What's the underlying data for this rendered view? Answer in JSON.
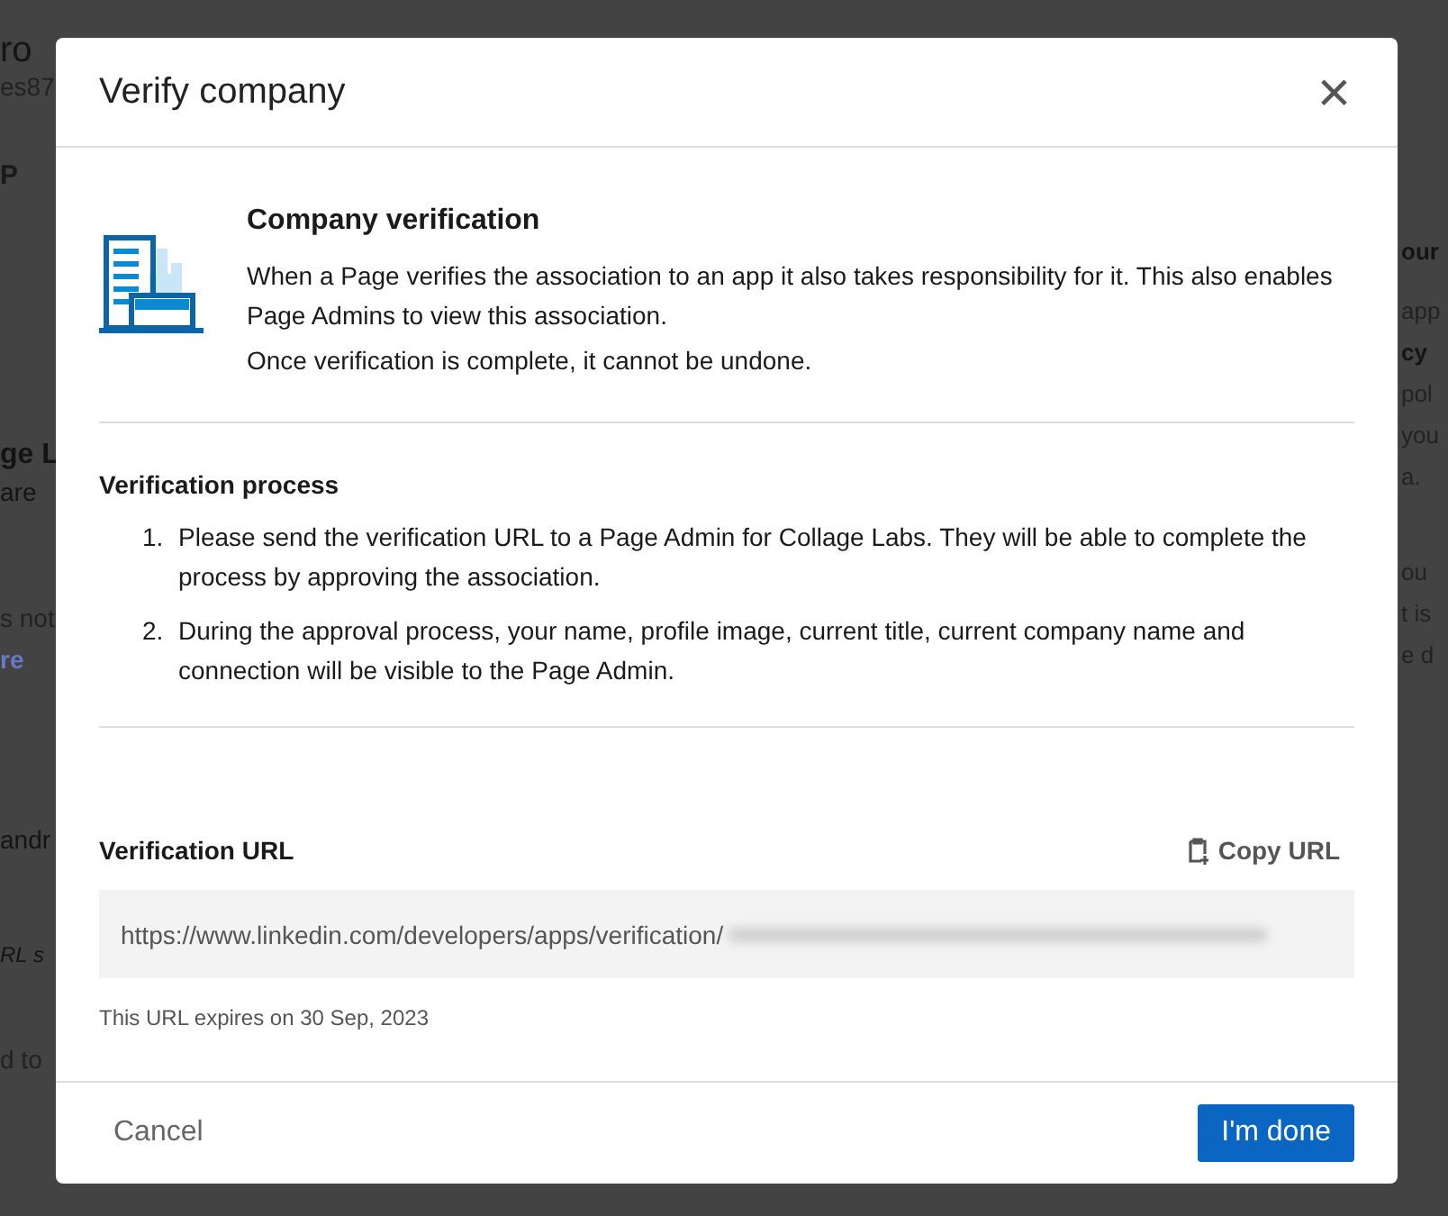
{
  "background_page": {
    "left_fragments": [
      {
        "text": "ro",
        "kind": "title"
      },
      {
        "text": "es87",
        "kind": "muted"
      },
      {
        "text": "P",
        "kind": "tab"
      },
      {
        "text": "ge L",
        "kind": "bold"
      },
      {
        "text": "are",
        "kind": "plain"
      },
      {
        "text": "s not",
        "kind": "muted"
      },
      {
        "text": "re",
        "kind": "link"
      },
      {
        "text": "andr",
        "kind": "plain"
      },
      {
        "text": "RL s",
        "kind": "italic"
      },
      {
        "text": "d to",
        "kind": "muted"
      }
    ],
    "right_fragments": [
      {
        "text": "our",
        "kind": "bold"
      },
      {
        "text": "app",
        "kind": "muted"
      },
      {
        "text": "cy",
        "kind": "bold"
      },
      {
        "text": "pol",
        "kind": "muted"
      },
      {
        "text": "you",
        "kind": "muted"
      },
      {
        "text": "a.",
        "kind": "muted"
      },
      {
        "text": "ou",
        "kind": "muted"
      },
      {
        "text": "t is",
        "kind": "muted"
      },
      {
        "text": "e d",
        "kind": "muted"
      }
    ]
  },
  "dialog": {
    "title": "Verify company",
    "close": "×",
    "intro": {
      "heading": "Company verification",
      "paragraphs": [
        "When a Page verifies the association to an app it also takes responsibility for it. This also enables Page Admins to view this association.",
        "Once verification is complete, it cannot be undone."
      ]
    },
    "process": {
      "heading": "Verification process",
      "steps": [
        {
          "number": "1.",
          "text": "Please send the verification URL to a Page Admin for Collage Labs. They will be able to complete the process by approving the association."
        },
        {
          "number": "2.",
          "text": "During the approval process, your name, profile image, current title, current company name and connection will be visible to the Page Admin."
        }
      ]
    },
    "url": {
      "heading": "Verification URL",
      "copy_button": "Copy URL",
      "value": "https://www.linkedin.com/developers/apps/verification/",
      "expiry": "This URL expires on 30 Sep, 2023"
    },
    "footer": {
      "cancel": "Cancel",
      "done": "I'm done"
    }
  }
}
